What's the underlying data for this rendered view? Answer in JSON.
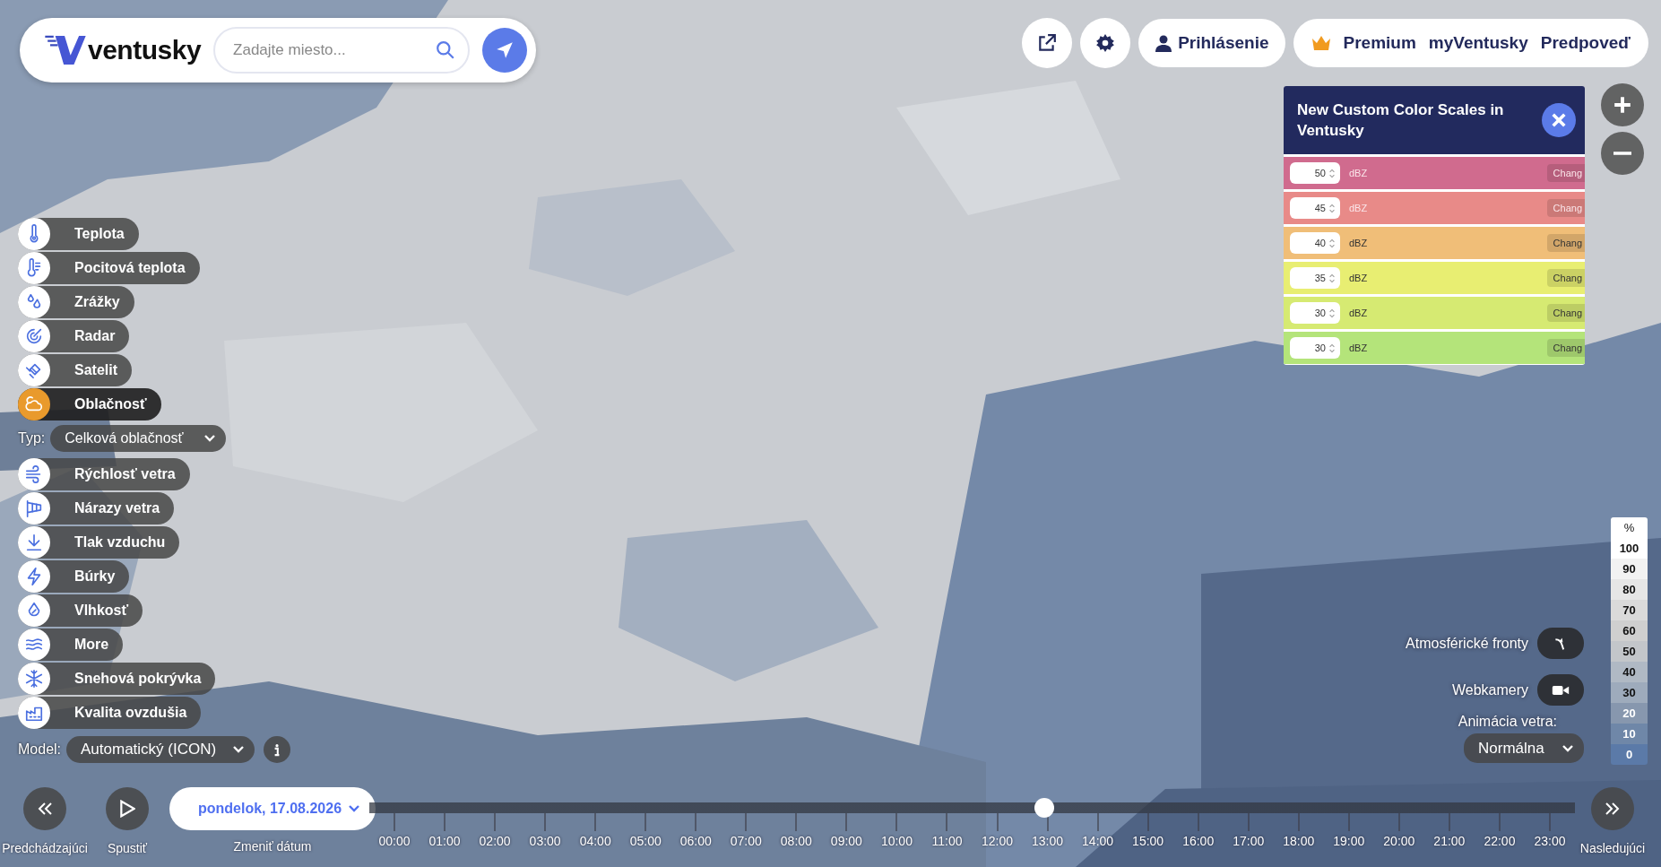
{
  "header": {
    "logo": "ventusky",
    "search": {
      "placeholder": "Zadajte miesto..."
    }
  },
  "top_bar": {
    "login": "Prihlásenie",
    "nav": [
      "Premium",
      "myVentusky",
      "Predpoveď"
    ]
  },
  "popup": {
    "title": "New Custom Color Scales in Ventusky",
    "rows": [
      {
        "value": "50",
        "unit": "dBZ",
        "button": "Chang",
        "color": "#d06b8e"
      },
      {
        "value": "45",
        "unit": "dBZ",
        "button": "Chang",
        "color": "#e88a88"
      },
      {
        "value": "40",
        "unit": "dBZ",
        "button": "Chang",
        "color": "#f0be78"
      },
      {
        "value": "35",
        "unit": "dBZ",
        "button": "Chang",
        "color": "#e8ee72"
      },
      {
        "value": "30",
        "unit": "dBZ",
        "button": "Chang",
        "color": "#d6ea72"
      },
      {
        "value": "30",
        "unit": "dBZ",
        "button": "Chang",
        "color": "#b4e47a"
      }
    ]
  },
  "layers": [
    {
      "label": "Teplota",
      "kind": "thermometer",
      "selected": false
    },
    {
      "label": "Pocitová teplota",
      "kind": "feels",
      "selected": false
    },
    {
      "label": "Zrážky",
      "kind": "drops",
      "selected": false
    },
    {
      "label": "Radar",
      "kind": "radar",
      "selected": false
    },
    {
      "label": "Satelit",
      "kind": "satellite",
      "selected": false
    },
    {
      "label": "Oblačnosť",
      "kind": "cloud",
      "selected": true,
      "type": {
        "label": "Typ:",
        "value": "Celková oblačnosť"
      }
    },
    {
      "label": "Rýchlosť vetra",
      "kind": "wind",
      "selected": false
    },
    {
      "label": "Nárazy vetra",
      "kind": "windsock",
      "selected": false
    },
    {
      "label": "Tlak vzduchu",
      "kind": "pressure",
      "selected": false
    },
    {
      "label": "Búrky",
      "kind": "bolt",
      "selected": false
    },
    {
      "label": "Vlhkosť",
      "kind": "drop",
      "selected": false
    },
    {
      "label": "More",
      "kind": "waves",
      "selected": false
    },
    {
      "label": "Snehová pokrývka",
      "kind": "snow",
      "selected": false
    },
    {
      "label": "Kvalita ovzdušia",
      "kind": "factory",
      "selected": false
    }
  ],
  "model": {
    "label": "Model:",
    "value": "Automatický (ICON)"
  },
  "timeline": {
    "previous": "Predchádzajúci",
    "play": "Spustiť",
    "date": "pondelok, 17.08.2026",
    "change_date": "Zmeniť dátum",
    "next": "Nasledujúci",
    "level": 0.56,
    "hours": [
      "00:00",
      "01:00",
      "02:00",
      "03:00",
      "04:00",
      "05:00",
      "06:00",
      "07:00",
      "08:00",
      "09:00",
      "10:00",
      "11:00",
      "12:00",
      "13:00",
      "14:00",
      "15:00",
      "16:00",
      "17:00",
      "18:00",
      "19:00",
      "20:00",
      "21:00",
      "22:00",
      "23:00"
    ]
  },
  "overlays": {
    "fronts": {
      "label": "Atmosférické fronty",
      "on": true
    },
    "webcams": {
      "label": "Webkamery",
      "on": true
    },
    "wind_animation": {
      "label": "Animácia vetra:",
      "value": "Normálna"
    }
  },
  "legend": {
    "unit": "%",
    "steps": [
      {
        "label": "100",
        "color": "#ffffff"
      },
      {
        "label": "90",
        "color": "#f2f2f2"
      },
      {
        "label": "80",
        "color": "#e6e6e6"
      },
      {
        "label": "70",
        "color": "#dadada"
      },
      {
        "label": "60",
        "color": "#cfcfcf"
      },
      {
        "label": "50",
        "color": "#c3c6ca"
      },
      {
        "label": "40",
        "color": "#b0b9c4"
      },
      {
        "label": "30",
        "color": "#9eabbc"
      },
      {
        "label": "20",
        "color": "#8797ae"
      },
      {
        "label": "10",
        "color": "#6f87a8"
      },
      {
        "label": "0",
        "color": "#5b7aa8"
      }
    ]
  }
}
